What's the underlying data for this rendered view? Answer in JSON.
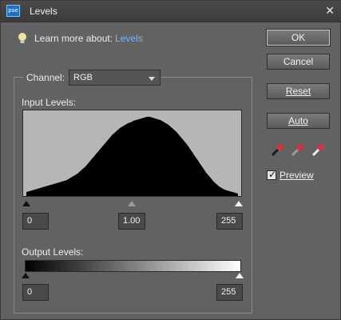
{
  "window": {
    "title": "Levels",
    "icon_text": "pse"
  },
  "help": {
    "prefix": "Learn more about:",
    "link": "Levels"
  },
  "buttons": {
    "ok": "OK",
    "cancel": "Cancel",
    "reset": "Reset",
    "auto": "Auto"
  },
  "preview": {
    "label": "Preview",
    "checked": true
  },
  "channel": {
    "label": "Channel:",
    "value": "RGB"
  },
  "input_levels": {
    "label": "Input Levels:",
    "black": "0",
    "gamma": "1.00",
    "white": "255"
  },
  "output_levels": {
    "label": "Output Levels:",
    "black": "0",
    "white": "255"
  },
  "histogram": {
    "values": [
      0.05,
      0.06,
      0.07,
      0.08,
      0.09,
      0.1,
      0.11,
      0.12,
      0.13,
      0.14,
      0.15,
      0.16,
      0.17,
      0.18,
      0.19,
      0.2,
      0.22,
      0.24,
      0.26,
      0.28,
      0.31,
      0.34,
      0.37,
      0.41,
      0.45,
      0.49,
      0.53,
      0.57,
      0.61,
      0.65,
      0.69,
      0.73,
      0.77,
      0.8,
      0.83,
      0.86,
      0.88,
      0.9,
      0.92,
      0.93,
      0.95,
      0.96,
      0.97,
      0.98,
      0.99,
      1.0,
      1.0,
      0.99,
      0.98,
      0.97,
      0.96,
      0.94,
      0.92,
      0.9,
      0.87,
      0.84,
      0.81,
      0.77,
      0.73,
      0.69,
      0.65,
      0.6,
      0.55,
      0.5,
      0.45,
      0.4,
      0.35,
      0.3,
      0.26,
      0.22,
      0.18,
      0.15,
      0.12,
      0.1,
      0.08,
      0.07,
      0.06,
      0.05,
      0.04,
      0.03
    ]
  },
  "colors": {
    "dialog_bg": "#626262",
    "link": "#6fb6ff",
    "dropper_red": "#c43a4a"
  },
  "icons": {
    "title": "photoshop-elements-icon",
    "help": "lightbulb-icon",
    "close": "close-icon",
    "droppers": [
      "black-eyedropper-icon",
      "gray-eyedropper-icon",
      "white-eyedropper-icon"
    ]
  }
}
